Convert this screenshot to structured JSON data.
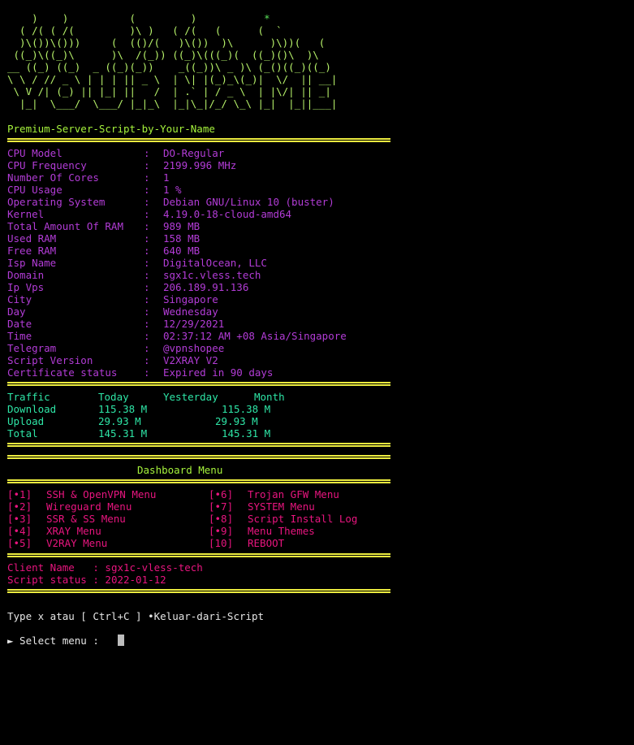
{
  "colors": {
    "background": "#000000",
    "banner_green": "#b7f26a",
    "banner_star": "#5be35b",
    "title_green": "#a6f33c",
    "separator_yellow": "#ecec3f",
    "info_purple": "#b23cd6",
    "traffic_cyan": "#2ee5a6",
    "menu_title": "#a6f33c",
    "menu_pink": "#e8157f",
    "plain_text": "#e6e6e6"
  },
  "banner": {
    "star": "*",
    "lines": [
      "    )    )          (         )           *   ",
      "  ( /( ( /(         )\\ )   ( /(   (      (  `  ",
      "  )\\())\\()))     (  (()/(   )\\())  )\\      )\\))(   (   ",
      " ((_)\\((_)\\      )\\  /(_)) ((_)\\(((_)(  ((_)()\\  )\\  ",
      "__ ((_) ((_)  _ ((_)(_))    _((_))\\ _ )\\ (_()((_)((_) ",
      "\\ \\ / // _ \\ | | | || _ \\  | \\| |(_)_\\(_)|  \\/  || __|",
      " \\ V /| (_) || |_| ||   /  | .` | / _ \\  | |\\/| || _| ",
      "  |_|  \\___/  \\___/ |_|_\\  |_|\\_|/_/ \\_\\ |_|  |_||___|"
    ]
  },
  "script_title": "Premium-Server-Script-by-Your-Name",
  "system_info": [
    {
      "label": "CPU Model",
      "value": "DO-Regular"
    },
    {
      "label": "CPU Frequency",
      "value": "2199.996 MHz"
    },
    {
      "label": "Number Of Cores",
      "value": "1"
    },
    {
      "label": "CPU Usage",
      "value": "1 %"
    },
    {
      "label": "Operating System",
      "value": "Debian GNU/Linux 10 (buster)"
    },
    {
      "label": "Kernel",
      "value": "4.19.0-18-cloud-amd64"
    },
    {
      "label": "Total Amount Of RAM",
      "value": "989 MB"
    },
    {
      "label": "Used RAM",
      "value": "158 MB"
    },
    {
      "label": "Free RAM",
      "value": "640 MB"
    },
    {
      "label": "Isp Name",
      "value": "DigitalOcean, LLC"
    },
    {
      "label": "Domain",
      "value": "sgx1c.vless.tech"
    },
    {
      "label": "Ip Vps",
      "value": "206.189.91.136"
    },
    {
      "label": "City",
      "value": "Singapore"
    },
    {
      "label": "Day",
      "value": "Wednesday"
    },
    {
      "label": "Date",
      "value": "12/29/2021"
    },
    {
      "label": "Time",
      "value": "02:37:12 AM +08 Asia/Singapore"
    },
    {
      "label": "Telegram",
      "value": "@vpnshopee"
    },
    {
      "label": "Script Version",
      "value": "V2XRAY V2"
    },
    {
      "label": "Certificate status",
      "value": "Expired in 90 days"
    }
  ],
  "separator": ":",
  "traffic": {
    "headers": [
      "Traffic",
      "Today",
      "Yesterday",
      "Month"
    ],
    "rows": [
      {
        "label": "Download",
        "today": "115.38 M",
        "month": "115.38 M"
      },
      {
        "label": "Upload",
        "today": "29.93 M",
        "month": "29.93 M"
      },
      {
        "label": "Total",
        "today": "145.31 M",
        "month": "145.31 M"
      }
    ]
  },
  "menu": {
    "title": "Dashboard Menu",
    "items": [
      {
        "key": "[•1]",
        "label": "SSH & OpenVPN Menu"
      },
      {
        "key": "[•2]",
        "label": "Wireguard Menu"
      },
      {
        "key": "[•3]",
        "label": "SSR & SS Menu"
      },
      {
        "key": "[•4]",
        "label": "XRAY Menu"
      },
      {
        "key": "[•5]",
        "label": "V2RAY Menu"
      },
      {
        "key": "[•6]",
        "label": "Trojan GFW Menu"
      },
      {
        "key": "[•7]",
        "label": "SYSTEM Menu"
      },
      {
        "key": "[•8]",
        "label": "Script Install Log"
      },
      {
        "key": "[•9]",
        "label": "Menu Themes"
      },
      {
        "key": "[10]",
        "label": "REBOOT"
      }
    ]
  },
  "client": {
    "name_label": "Client Name   :",
    "name_value": "sgx1c-vless-tech",
    "status_label": "Script status :",
    "status_value": "2022-01-12"
  },
  "exit_hint": "Type x atau [ Ctrl+C ] •Keluar-dari-Script",
  "prompt": "► Select menu :"
}
